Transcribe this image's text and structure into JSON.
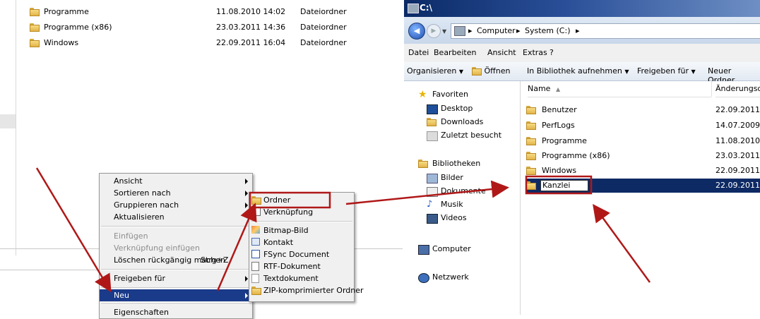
{
  "left_files": [
    {
      "name": "Programme",
      "date": "11.08.2010 14:02",
      "type": "Dateiordner"
    },
    {
      "name": "Programme (x86)",
      "date": "23.03.2011 14:36",
      "type": "Dateiordner"
    },
    {
      "name": "Windows",
      "date": "22.09.2011 16:04",
      "type": "Dateiordner"
    }
  ],
  "context_menu": {
    "items": [
      "Ansicht",
      "Sortieren nach",
      "Gruppieren nach",
      "Aktualisieren",
      "Einfügen",
      "Verknüpfung einfügen",
      "Löschen rückgängig machen",
      "Freigeben für",
      "Neu",
      "Eigenschaften"
    ],
    "undo_shortcut": "Strg+Z"
  },
  "new_submenu": {
    "items": [
      "Ordner",
      "Verknüpfung",
      "Bitmap-Bild",
      "Kontakt",
      "FSync Document",
      "RTF-Dokument",
      "Textdokument",
      "ZIP-komprimierter Ordner"
    ]
  },
  "window": {
    "title": "C:\\",
    "breadcrumb": [
      "Computer",
      "System (C:)"
    ],
    "menu": [
      "Datei",
      "Bearbeiten",
      "Ansicht",
      "Extras",
      "?"
    ],
    "toolbar": [
      "Organisieren",
      "Öffnen",
      "In Bibliothek aufnehmen",
      "Freigeben für",
      "Neuer Ordner"
    ],
    "nav": {
      "favorites": "Favoriten",
      "favorites_items": [
        "Desktop",
        "Downloads",
        "Zuletzt besucht"
      ],
      "libraries": "Bibliotheken",
      "libraries_items": [
        "Bilder",
        "Dokumente",
        "Musik",
        "Videos"
      ],
      "computer": "Computer",
      "network": "Netzwerk"
    },
    "columns": {
      "name": "Name",
      "date": "Änderungsd"
    },
    "files": [
      {
        "name": "Benutzer",
        "date": "22.09.2011"
      },
      {
        "name": "PerfLogs",
        "date": "14.07.2009"
      },
      {
        "name": "Programme",
        "date": "11.08.2010"
      },
      {
        "name": "Programme (x86)",
        "date": "23.03.2011"
      },
      {
        "name": "Windows",
        "date": "22.09.2011"
      },
      {
        "name": "Kanzlei",
        "date": "22.09.2011"
      }
    ]
  },
  "colors": {
    "highlight": "#1a3a8a",
    "annotation": "#b01818",
    "selection": "#0e2a64"
  }
}
